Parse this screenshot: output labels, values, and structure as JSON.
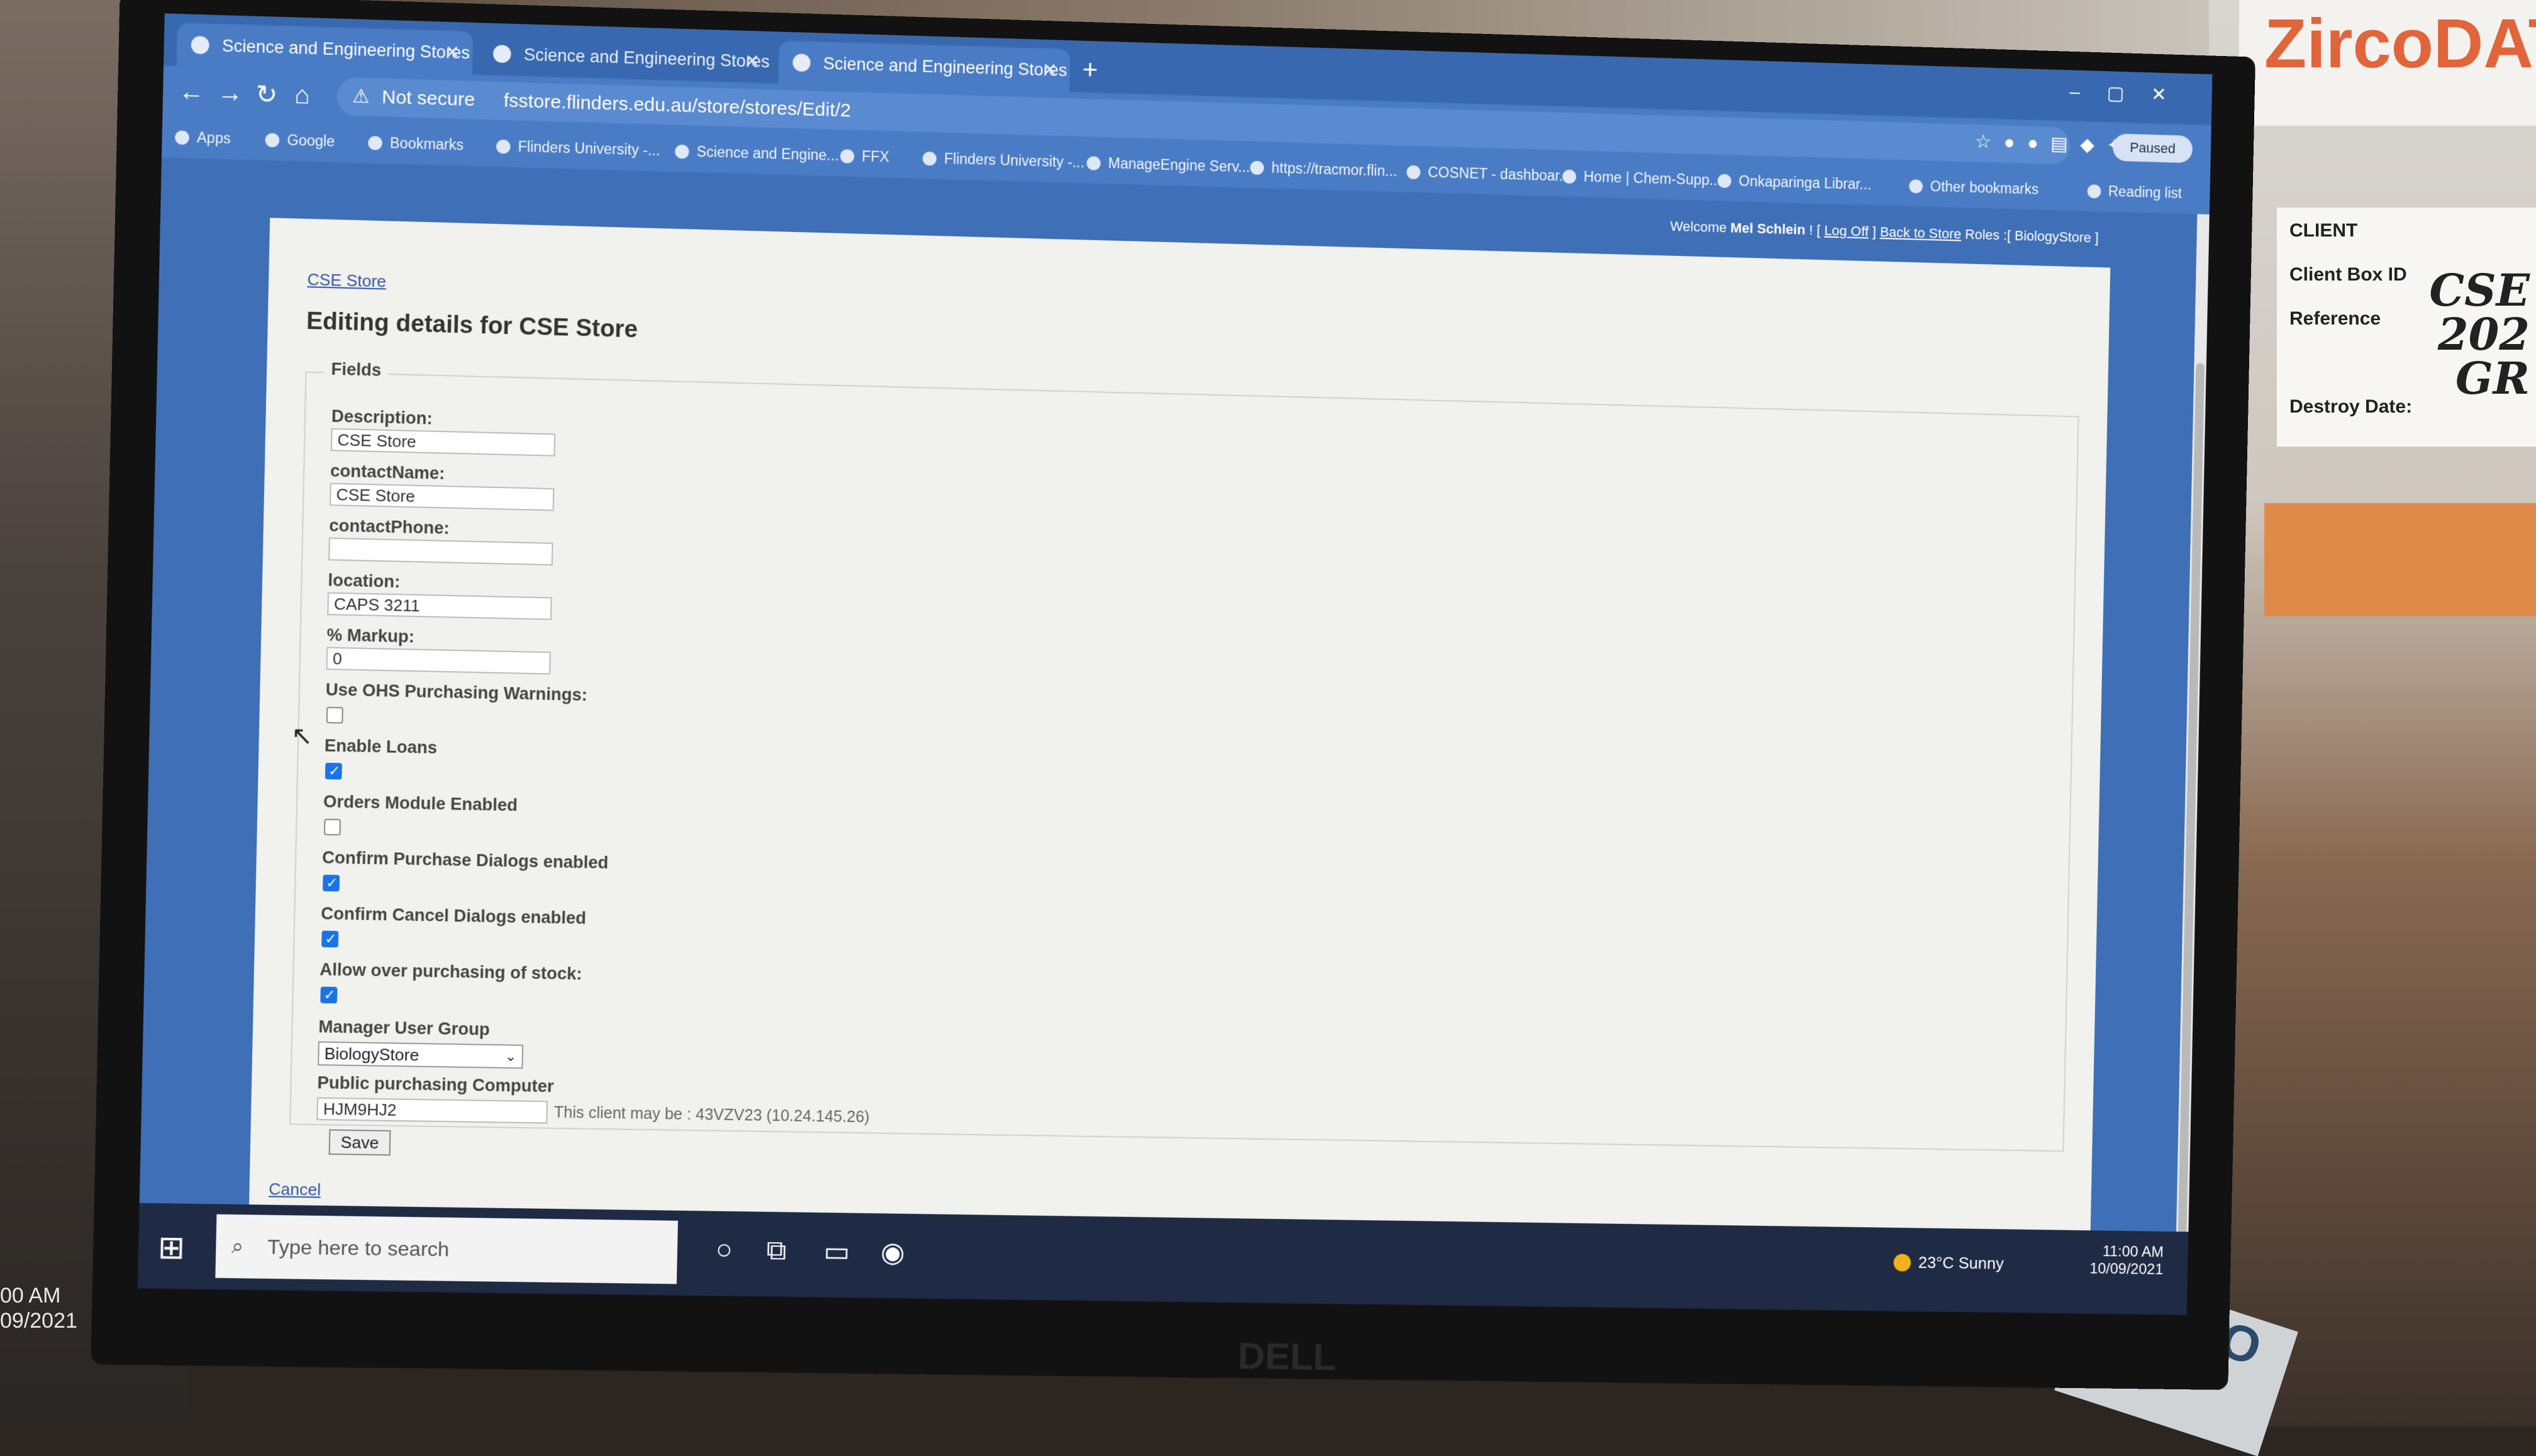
{
  "surroundings": {
    "box_brand": "ZircoDAT",
    "client_card": {
      "header": "CLIENT",
      "client_box_id_label": "Client Box ID",
      "client_box_id_value": "CSE",
      "reference_label": "Reference",
      "reference_value": "202",
      "reference_value_2": "GR",
      "destroy_date_label": "Destroy Date:"
    },
    "dymo_label": "DYMO",
    "left_screen_clock": "00 AM",
    "left_screen_date": "09/2021",
    "monitor_brand": "DELL"
  },
  "browser": {
    "tabs": [
      {
        "title": "Science and Engineering Stores"
      },
      {
        "title": "Science and Engineering Stores"
      },
      {
        "title": "Science and Engineering Stores"
      }
    ],
    "new_tab": "+",
    "address": {
      "security": "Not secure",
      "url": "fsstore.flinders.edu.au/store/stores/Edit/2"
    },
    "profile_label": "Paused",
    "bookmarks": [
      "Apps",
      "Google",
      "Bookmarks",
      "Flinders University -...",
      "Science and Engine...",
      "FFX",
      "Flinders University -...",
      "ManageEngine Serv...",
      "https://tracmor.flin...",
      "COSNET - dashboar...",
      "Home | Chem-Supp...",
      "Onkaparinga Librar..."
    ],
    "other_bookmarks": "Other bookmarks",
    "reading_list": "Reading list"
  },
  "header": {
    "welcome_prefix": "Welcome",
    "user_name": "Mel Schlein",
    "welcome_sep": "! [",
    "log_off": "Log Off",
    "sep2": "]",
    "back_to_store": "Back to Store",
    "roles_text": "Roles :[ BiologyStore ]"
  },
  "form": {
    "breadcrumb": "CSE Store",
    "title": "Editing details for CSE Store",
    "legend": "Fields",
    "description_label": "Description:",
    "description_value": "CSE Store",
    "contact_name_label": "contactName:",
    "contact_name_value": "CSE Store",
    "contact_phone_label": "contactPhone:",
    "contact_phone_value": "",
    "location_label": "location:",
    "location_value": "CAPS 3211",
    "markup_label": "% Markup:",
    "markup_value": "0",
    "ohs_label": "Use OHS Purchasing Warnings:",
    "ohs_checked": false,
    "loans_label": "Enable Loans",
    "loans_checked": true,
    "orders_label": "Orders Module Enabled",
    "orders_checked": false,
    "confirm_purchase_label": "Confirm Purchase Dialogs enabled",
    "confirm_purchase_checked": true,
    "confirm_cancel_label": "Confirm Cancel Dialogs enabled",
    "confirm_cancel_checked": true,
    "over_purchase_label": "Allow over purchasing of stock:",
    "over_purchase_checked": true,
    "manager_group_label": "Manager User Group",
    "manager_group_value": "BiologyStore",
    "public_computer_label": "Public purchasing Computer",
    "public_computer_value": "HJM9HJ2",
    "client_hint": "This client may be : 43VZV23 (10.24.145.26)",
    "save_label": "Save",
    "cancel_label": "Cancel"
  },
  "taskbar": {
    "search_placeholder": "Type here to search",
    "weather": "23°C  Sunny",
    "time": "11:00 AM",
    "date": "10/09/2021"
  }
}
